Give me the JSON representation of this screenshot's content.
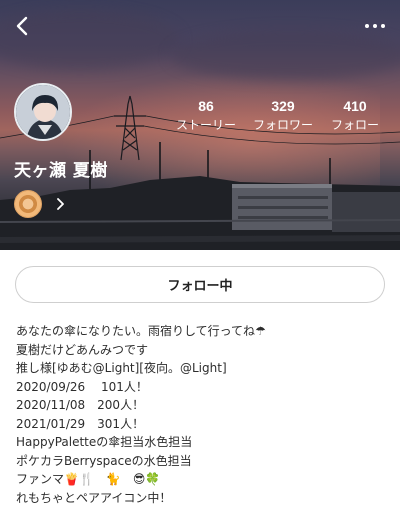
{
  "header": {
    "back_icon": "chevron-left-icon",
    "more_icon": "more-horizontal-icon"
  },
  "profile": {
    "name": "天ヶ瀬 夏樹",
    "stats": [
      {
        "value": "86",
        "label": "ストーリー"
      },
      {
        "value": "329",
        "label": "フォロワー"
      },
      {
        "value": "410",
        "label": "フォロー"
      }
    ],
    "badge_icon": "gold-medal-icon",
    "badge_chevron": "chevron-right-icon"
  },
  "actions": {
    "follow_label": "フォロー中"
  },
  "bio": [
    "あなたの傘になりたい。雨宿りして行ってね☂",
    "夏樹だけどあんみつです",
    "推し様[ゆあむ@Light][夜向。@Light]",
    "2020/09/26　 101人！",
    "2020/11/08　200人！",
    "2021/01/29　301人！",
    "HappyPaletteの傘担当水色担当",
    "ポケカラBerryspaceの水色担当",
    "ファンマ🍟🍴　🐈　😎🍀",
    "れもちゃとペアアイコン中！"
  ],
  "colors": {
    "sky_top": "#3b3d5a",
    "sky_glow": "#a0655e",
    "button_border": "#cfcfcf",
    "text": "#2d2d2d"
  }
}
